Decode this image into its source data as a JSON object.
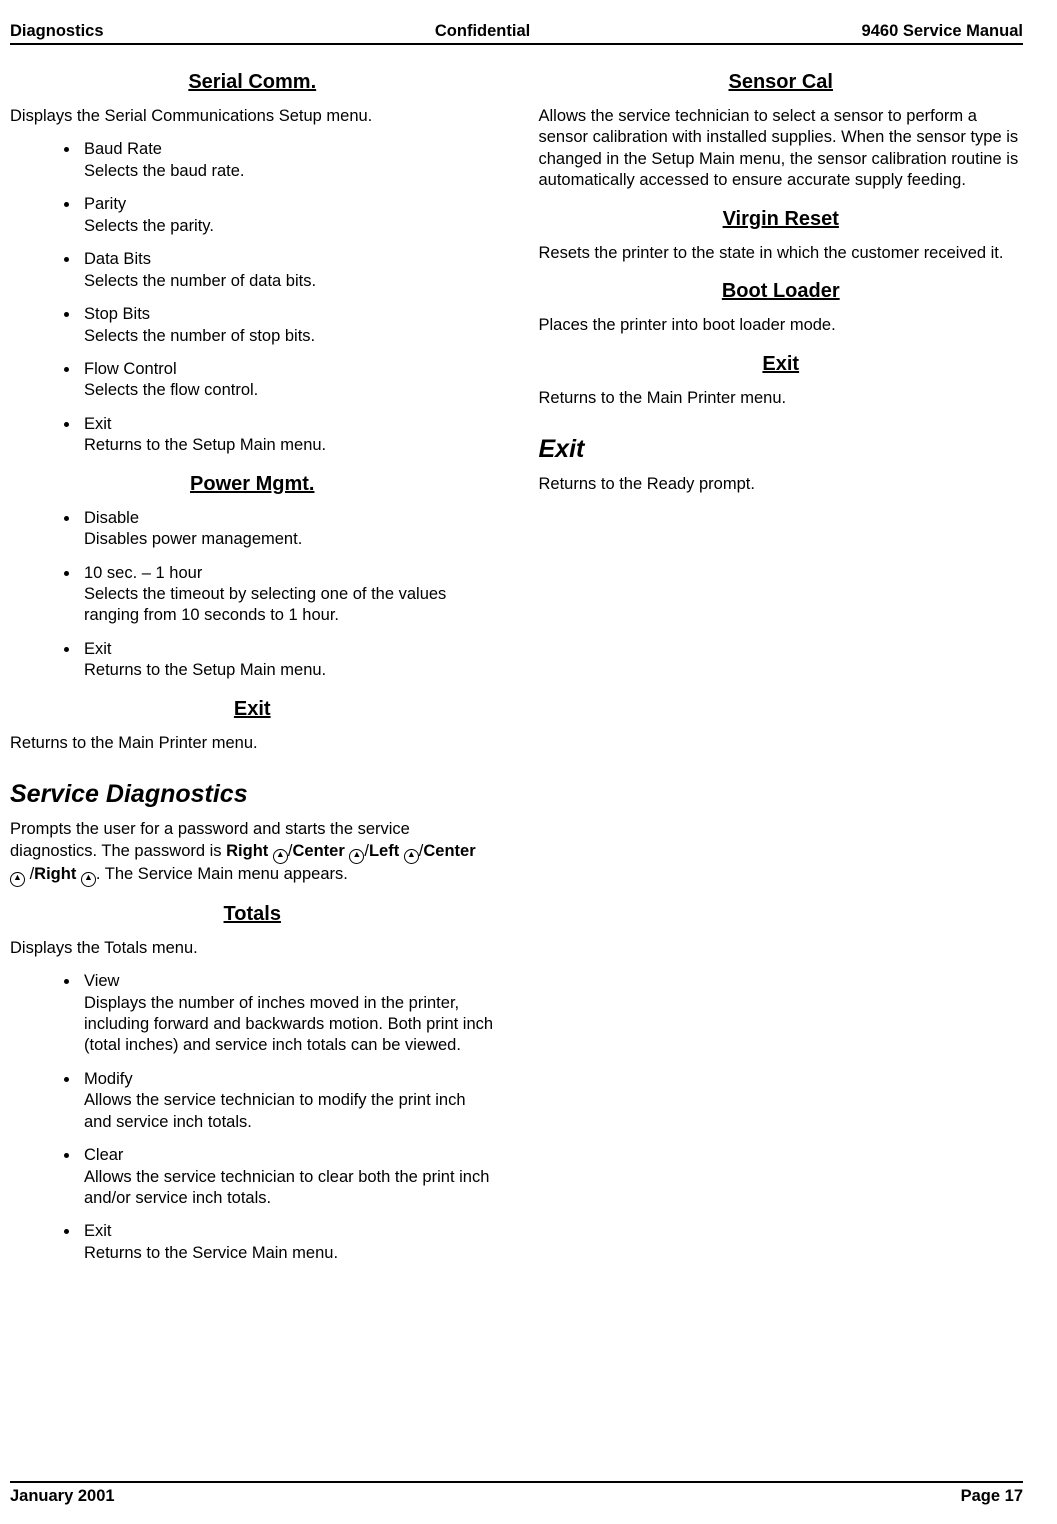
{
  "header": {
    "left": "Diagnostics",
    "center": "Confidential",
    "right": "9460 Service Manual"
  },
  "footer": {
    "left": "January 2001",
    "right": "Page 17"
  },
  "left": {
    "serial": {
      "title": "Serial Comm.",
      "intro": "Displays the Serial Communications Setup menu.",
      "items": [
        {
          "t": "Baud Rate",
          "d": "Selects the baud rate."
        },
        {
          "t": "Parity",
          "d": "Selects the parity."
        },
        {
          "t": "Data Bits",
          "d": "Selects the number of data bits."
        },
        {
          "t": "Stop Bits",
          "d": "Selects the number of stop bits."
        },
        {
          "t": "Flow Control",
          "d": "Selects the flow control."
        },
        {
          "t": "Exit",
          "d": "Returns to the Setup Main menu."
        }
      ]
    },
    "power": {
      "title": "Power Mgmt.",
      "items": [
        {
          "t": "Disable",
          "d": "Disables power management."
        },
        {
          "t": "10 sec. – 1 hour",
          "d": "Selects the timeout by selecting one of the values ranging from 10 seconds to 1 hour."
        },
        {
          "t": "Exit",
          "d": "Returns to the Setup Main menu."
        }
      ]
    },
    "exit1": {
      "title": "Exit",
      "text": "Returns to the Main Printer menu."
    },
    "svc": {
      "title": "Service Diagnostics",
      "p1a": "Prompts the user for a password and starts the service diagnostics.  The password is ",
      "right": "Right",
      "center": "Center",
      "left": "Left",
      "p1b": ".  The Service Main menu appears."
    },
    "totals": {
      "title": "Totals",
      "intro": "Displays the Totals menu.",
      "items": [
        {
          "t": "View",
          "d": "Displays the number of inches moved in the printer, including forward and backwards motion.  Both print inch (total inches) and service inch totals can be viewed."
        },
        {
          "t": "Modify",
          "d": "Allows the service technician to modify the print inch and service inch totals."
        },
        {
          "t": "Clear",
          "d": "Allows the service technician to clear both the print inch and/or service inch totals."
        },
        {
          "t": "Exit",
          "d": "Returns to the Service Main menu."
        }
      ]
    }
  },
  "right": {
    "sensor": {
      "title": "Sensor Cal",
      "text": "Allows the service technician to select a sensor to perform a sensor calibration with installed supplies.  When the sensor type is changed in the Setup Main menu, the sensor calibration routine is automatically accessed to ensure accurate supply feeding."
    },
    "virgin": {
      "title": "Virgin Reset",
      "text": "Resets the printer to the state in which the customer received it."
    },
    "boot": {
      "title": "Boot Loader",
      "text": "Places the printer into boot loader mode."
    },
    "exit2": {
      "title": "Exit",
      "text": "Returns to the Main Printer menu."
    },
    "exit3": {
      "title": "Exit",
      "text": "Returns to the Ready prompt."
    }
  }
}
